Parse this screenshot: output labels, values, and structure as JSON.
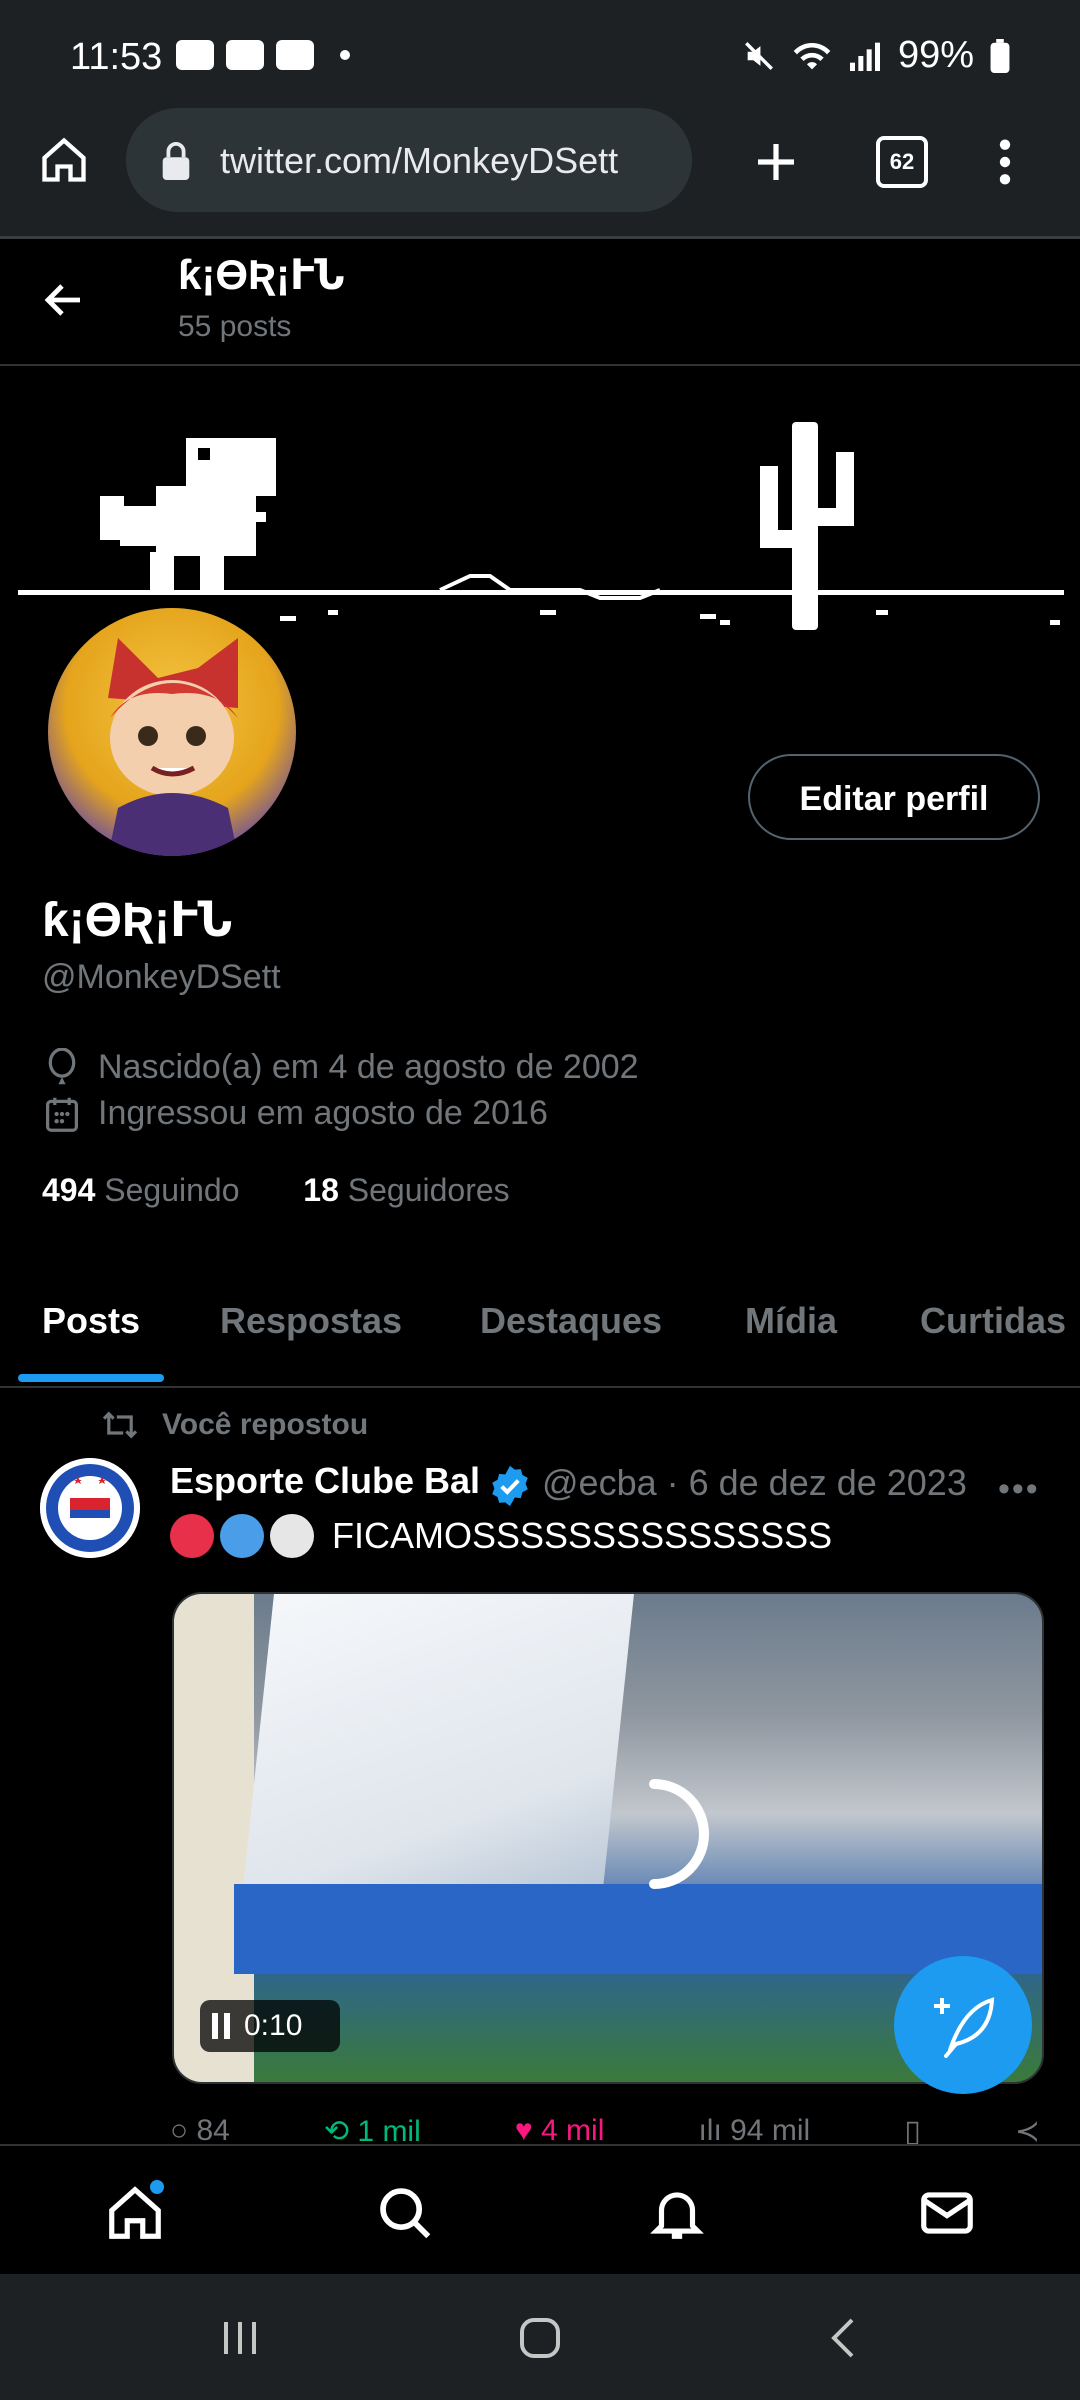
{
  "status_bar": {
    "time": "11:53",
    "battery": "99%",
    "icons": [
      "youtube-icon",
      "gallery-icon",
      "calendar-icon",
      "mute-icon",
      "wifi-icon",
      "signal-icon",
      "battery-icon"
    ]
  },
  "browser": {
    "url": "twitter.com/MonkeyDSett",
    "tab_count": "62"
  },
  "header": {
    "name": "ƙ¡ϴƦ¡ՒՆ",
    "post_count": "55 posts"
  },
  "profile": {
    "name": "ƙ¡ϴƦ¡ՒՆ",
    "handle": "@MonkeyDSett",
    "edit_label": "Editar perfil",
    "birth": "Nascido(a) em 4 de agosto de 2002",
    "joined": "Ingressou em agosto de 2016",
    "following_count": "494",
    "following_label": "Seguindo",
    "followers_count": "18",
    "followers_label": "Seguidores"
  },
  "tabs": [
    "Posts",
    "Respostas",
    "Destaques",
    "Mídia",
    "Curtidas"
  ],
  "tweet": {
    "repost_label": "Você repostou",
    "author": "Esporte Clube Bal",
    "meta": "@ecba · 6 de dez de 2023",
    "text": "FICAMOSSSSSSSSSSSSSSS",
    "circle_colors": [
      "#e8304a",
      "#4a9de8",
      "#e6e6e6"
    ],
    "video_time": "0:10",
    "replies": "84",
    "reposts": "1 mil",
    "likes": "4 mil",
    "views": "94 mil"
  },
  "colors": {
    "accent": "#1d9bf0",
    "background": "#000000",
    "muted_text": "#71767b",
    "repost_green": "#00ba7c",
    "like_pink": "#f91880"
  }
}
